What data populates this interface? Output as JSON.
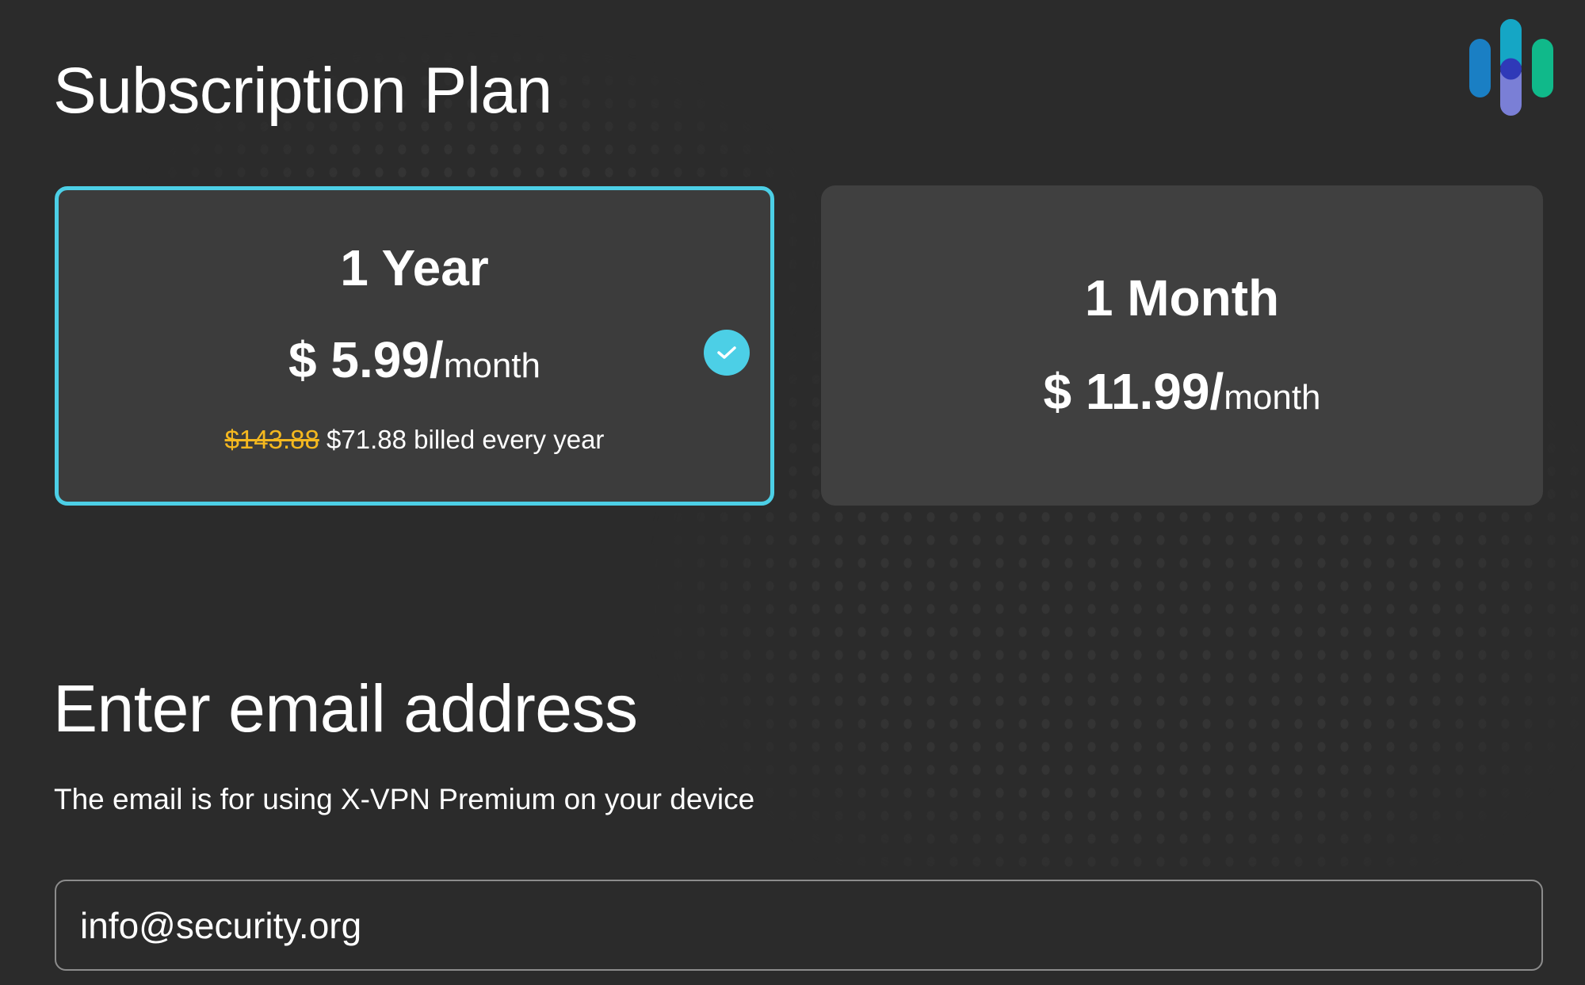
{
  "page": {
    "title": "Subscription Plan",
    "logo_icon": "brand-logo-bars"
  },
  "plans": [
    {
      "name": "1 Year",
      "price": "$ 5.99/",
      "unit": "month",
      "original_price": "$143.88",
      "billing_text": "$71.88 billed every year",
      "selected": true,
      "check_icon": "checkmark-circle"
    },
    {
      "name": "1 Month",
      "price": "$ 11.99/",
      "unit": "month",
      "selected": false
    }
  ],
  "email_section": {
    "title": "Enter email address",
    "subtitle": "The email is for using X-VPN Premium on your device",
    "email_value": "info@security.org"
  },
  "colors": {
    "accent": "#4ccfe6",
    "strike_price": "#f4b81f",
    "background": "#2b2b2b",
    "card_selected_bg": "#3c3c3c",
    "card_bg": "#404040"
  }
}
